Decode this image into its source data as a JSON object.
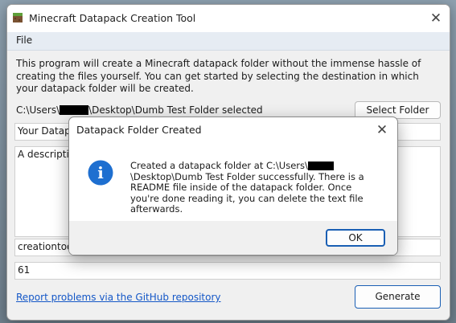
{
  "window": {
    "title": "Minecraft Datapack Creation Tool",
    "close_glyph": "✕"
  },
  "menu": {
    "file": "File"
  },
  "intro": "This program will create a Minecraft datapack folder without the immense hassle of creating the files yourself. You can get started by selecting the destination in which your datapack folder will be created.",
  "destination": {
    "prefix": "C:\\Users\\",
    "suffix": "\\Desktop\\Dumb Test Folder selected",
    "button": "Select Folder"
  },
  "fields": {
    "name_value": "Your Datapa",
    "description_value": "A description",
    "namespace_value": "creationtool",
    "version_value": "61"
  },
  "footer": {
    "link": "Report problems via the GitHub repository",
    "generate": "Generate"
  },
  "dialog": {
    "title": "Datapack Folder Created",
    "close_glyph": "✕",
    "msg_prefix": "Created a datapack folder at C:\\Users\\",
    "msg_suffix": "\\Desktop\\Dumb Test Folder successfully. There is a README file inside of the datapack folder. Once you're done reading it, you can delete the text file afterwards.",
    "ok": "OK",
    "icon_glyph": "i"
  },
  "colors": {
    "accent": "#1a5fb4",
    "info_icon": "#1e6fd0",
    "link": "#1457c7"
  },
  "icons": {
    "app": "minecraft-grass-block-icon",
    "info": "info-icon"
  }
}
